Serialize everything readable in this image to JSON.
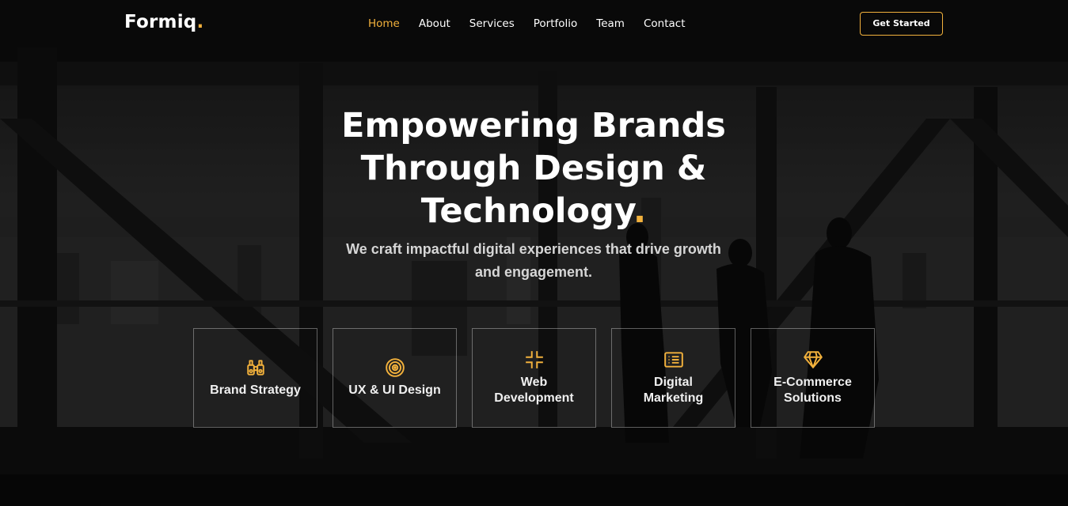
{
  "brand": {
    "name": "Formiq",
    "dot": "."
  },
  "nav": {
    "items": [
      "Home",
      "About",
      "Services",
      "Portfolio",
      "Team",
      "Contact"
    ],
    "active": "Home"
  },
  "cta": {
    "label": "Get Started"
  },
  "hero": {
    "headline_lines": [
      "Empowering Brands",
      "Through Design &",
      "Technology"
    ],
    "headline_dot": ".",
    "subtitle_lines": [
      "We craft impactful digital experiences that drive growth",
      "and engagement."
    ]
  },
  "services": [
    {
      "label": "Brand Strategy",
      "icon": "binoculars-icon"
    },
    {
      "label": "UX & UI Design",
      "icon": "target-icon"
    },
    {
      "label": "Web Development",
      "icon": "frame-corners-icon"
    },
    {
      "label": "Digital Marketing",
      "icon": "newspaper-icon"
    },
    {
      "label": "E-Commerce Solutions",
      "icon": "diamond-icon"
    }
  ],
  "colors": {
    "accent": "#f2b13c",
    "background": "#1c1c1c",
    "text": "#ffffff"
  }
}
